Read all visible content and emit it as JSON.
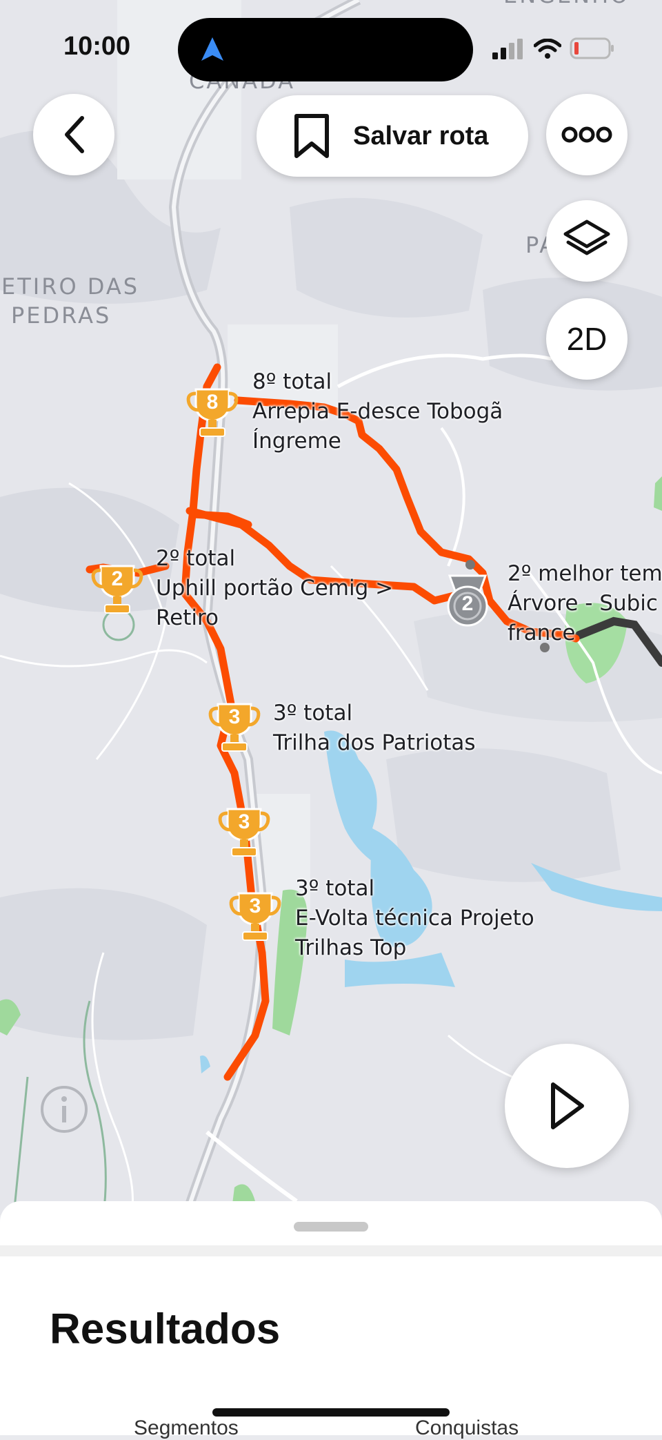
{
  "status_bar": {
    "time": "10:00"
  },
  "map": {
    "places": [
      "CANADA",
      "ETIRO DAS",
      "PEDRAS",
      "PAGAL",
      "ENGENHO"
    ],
    "segments": [
      {
        "rank": "8",
        "line1": "8º total",
        "line2": "Arrepia E-desce Tobogã",
        "line3": "Íngreme"
      },
      {
        "rank": "2",
        "line1": "2º total",
        "line2": "Uphill portão Cemig >",
        "line3": "Retiro"
      },
      {
        "rank": "2",
        "line1": "2º melhor tem",
        "line2": "Árvore - Subic",
        "line3": "france"
      },
      {
        "rank": "3",
        "line1": "3º total",
        "line2": "Trilha dos Patriotas"
      },
      {
        "rank": "3"
      },
      {
        "rank": "3",
        "line1": "3º total",
        "line2": "E-Volta técnica Projeto",
        "line3": "Trilhas Top"
      }
    ],
    "route_color": "#fc4c02",
    "trophy_color": "#f3a72b",
    "medal_color": "#8c8f94"
  },
  "toolbar": {
    "back_icon": "chevron-left-icon",
    "save_route_label": "Salvar rota",
    "more_icon": "more-icon",
    "layers_icon": "layers-icon",
    "view_mode_label": "2D"
  },
  "play_icon": "play-icon",
  "sheet": {
    "title": "Resultados",
    "tabs": [
      "Segmentos",
      "Conquistas"
    ]
  }
}
